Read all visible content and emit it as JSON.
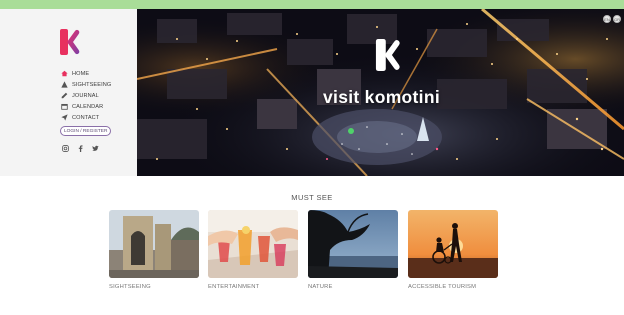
{
  "hero": {
    "brand_text": "visit komotini",
    "lang_buttons": [
      "EN",
      "GR"
    ]
  },
  "sidebar": {
    "nav": [
      {
        "label": "HOME",
        "icon": "home-icon"
      },
      {
        "label": "SIGHTSEEING",
        "icon": "landmark-icon"
      },
      {
        "label": "JOURNAL",
        "icon": "journal-icon"
      },
      {
        "label": "CALENDAR",
        "icon": "calendar-icon"
      },
      {
        "label": "CONTACT",
        "icon": "send-icon"
      }
    ],
    "login_label": "LOGIN / REGISTER",
    "social": [
      "instagram-icon",
      "facebook-icon",
      "twitter-icon"
    ]
  },
  "section": {
    "title": "MUST SEE",
    "cards": [
      {
        "caption": "SIGHTSEEING"
      },
      {
        "caption": "ENTERTAINMENT"
      },
      {
        "caption": "NATURE"
      },
      {
        "caption": "ACCESSIBLE TOURISM"
      }
    ]
  },
  "colors": {
    "top_strip": "#a9dd98",
    "brand_pink": "#e8315f",
    "brand_purple": "#7b3fa6",
    "home_active": "#e8315f"
  }
}
